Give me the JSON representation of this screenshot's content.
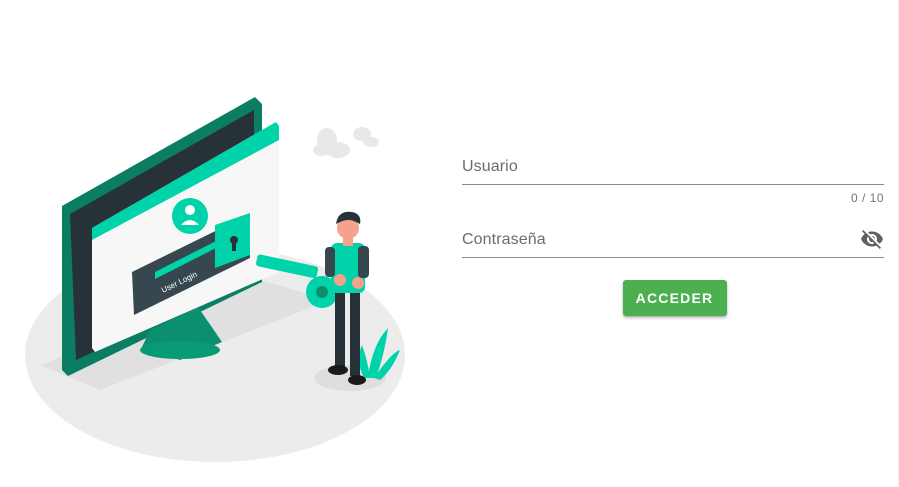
{
  "illustration": {
    "screen_label": "User Login",
    "accent_color": "#00d3aa",
    "dark_color": "#0b7d62"
  },
  "login_form": {
    "username": {
      "label": "Usuario",
      "value": "",
      "counter": "0 / 10"
    },
    "password": {
      "label": "Contraseña",
      "value": "",
      "toggle_icon": "eye-off-icon"
    },
    "submit_label": "ACCEDER",
    "submit_color": "#4caf50"
  }
}
